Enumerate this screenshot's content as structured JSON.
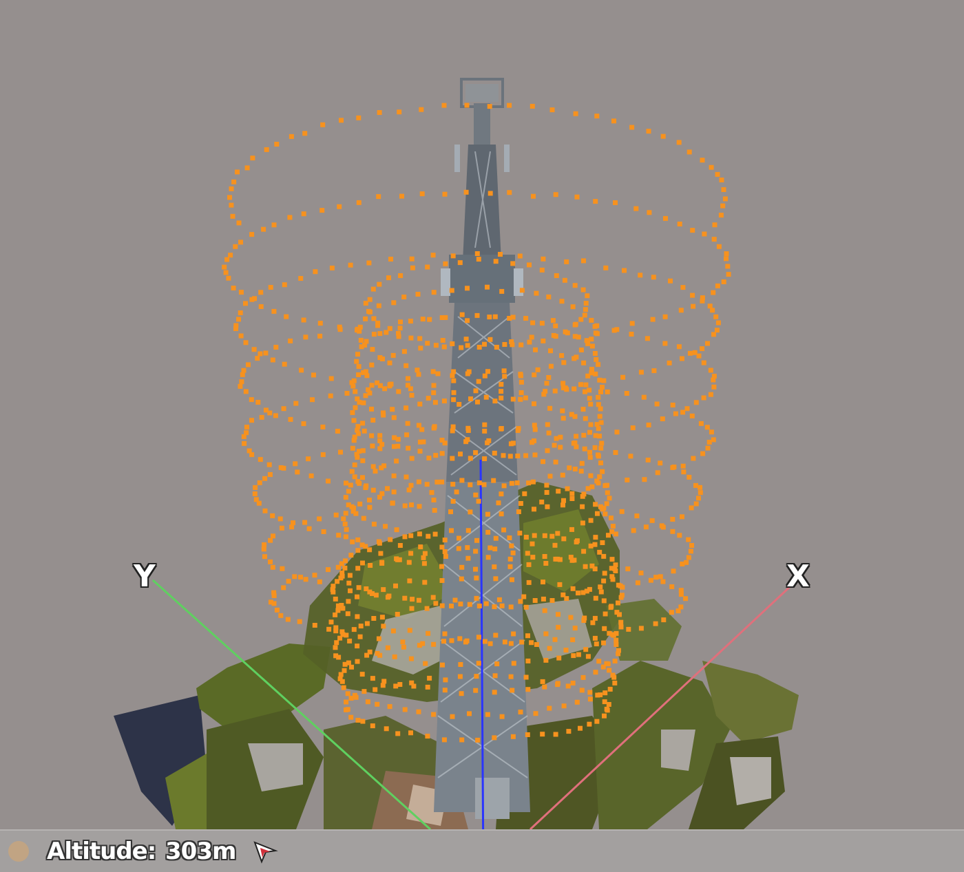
{
  "viewport": {
    "background_color": "#958f8e",
    "axes": {
      "x_label": "X",
      "y_label": "Y",
      "x_color": "#e0707c",
      "y_color": "#5fd060",
      "z_color": "#2a35ff"
    },
    "waypoint_color": "#f7921e",
    "model": "cell-tower"
  },
  "statusbar": {
    "status_icon": "circle-status-icon",
    "altitude_label": "Altitude:",
    "altitude_value": "303m",
    "cursor_icon": "pointer-arrow-icon"
  }
}
